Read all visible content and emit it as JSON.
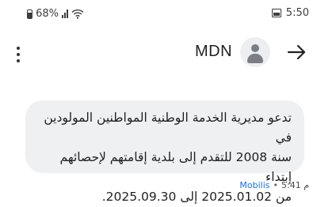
{
  "status_bar": {
    "time": "5:50",
    "battery": "68%",
    "battery_level": 0.68,
    "icons": [
      "image-icon",
      "wifi-icon",
      "signal-icon",
      "battery-icon"
    ]
  },
  "header": {
    "contact_name": "MDN",
    "icons": [
      "more-vert-icon",
      "avatar-icon",
      "back-arrow-icon"
    ]
  },
  "message": {
    "text": "تدعو مديرية الخدمة الوطنية المواطنين المولودين في\nسنة 2008 للتقدم إلى بلدية إقامتهم لإحصائهم إبتداء\nمن 2025.01.02 إلى 2025.09.30.",
    "time": "5:41 م",
    "separator": "•",
    "sender": "Mobilis"
  },
  "colors": {
    "bubble_bg": "#eef0f2",
    "sender_link": "#1a73e8"
  }
}
